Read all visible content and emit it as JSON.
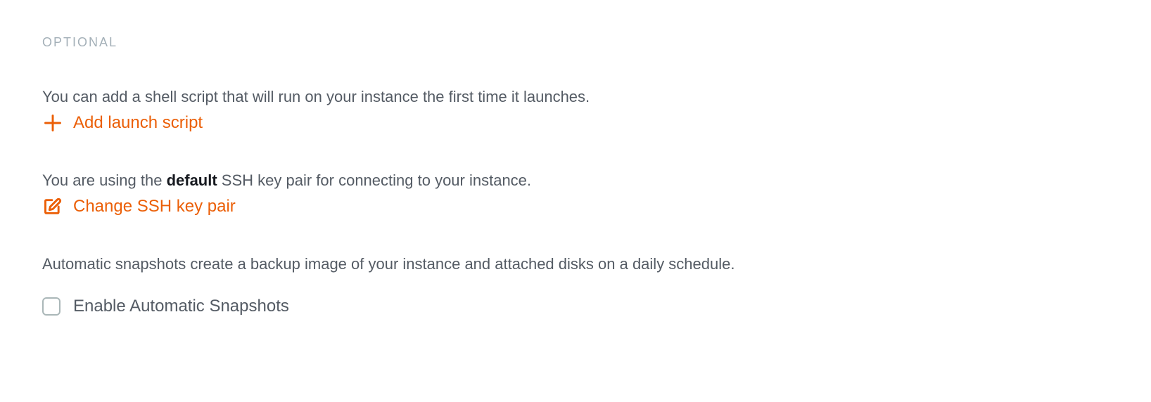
{
  "heading": "OPTIONAL",
  "launch_script": {
    "description": "You can add a shell script that will run on your instance the first time it launches.",
    "action_label": "Add launch script"
  },
  "ssh_key": {
    "description_prefix": "You are using the ",
    "description_bold": "default",
    "description_suffix": " SSH key pair for connecting to your instance.",
    "action_label": "Change SSH key pair"
  },
  "snapshots": {
    "description": "Automatic snapshots create a backup image of your instance and attached disks on a daily schedule.",
    "checkbox_label": "Enable Automatic Snapshots",
    "checked": false
  }
}
